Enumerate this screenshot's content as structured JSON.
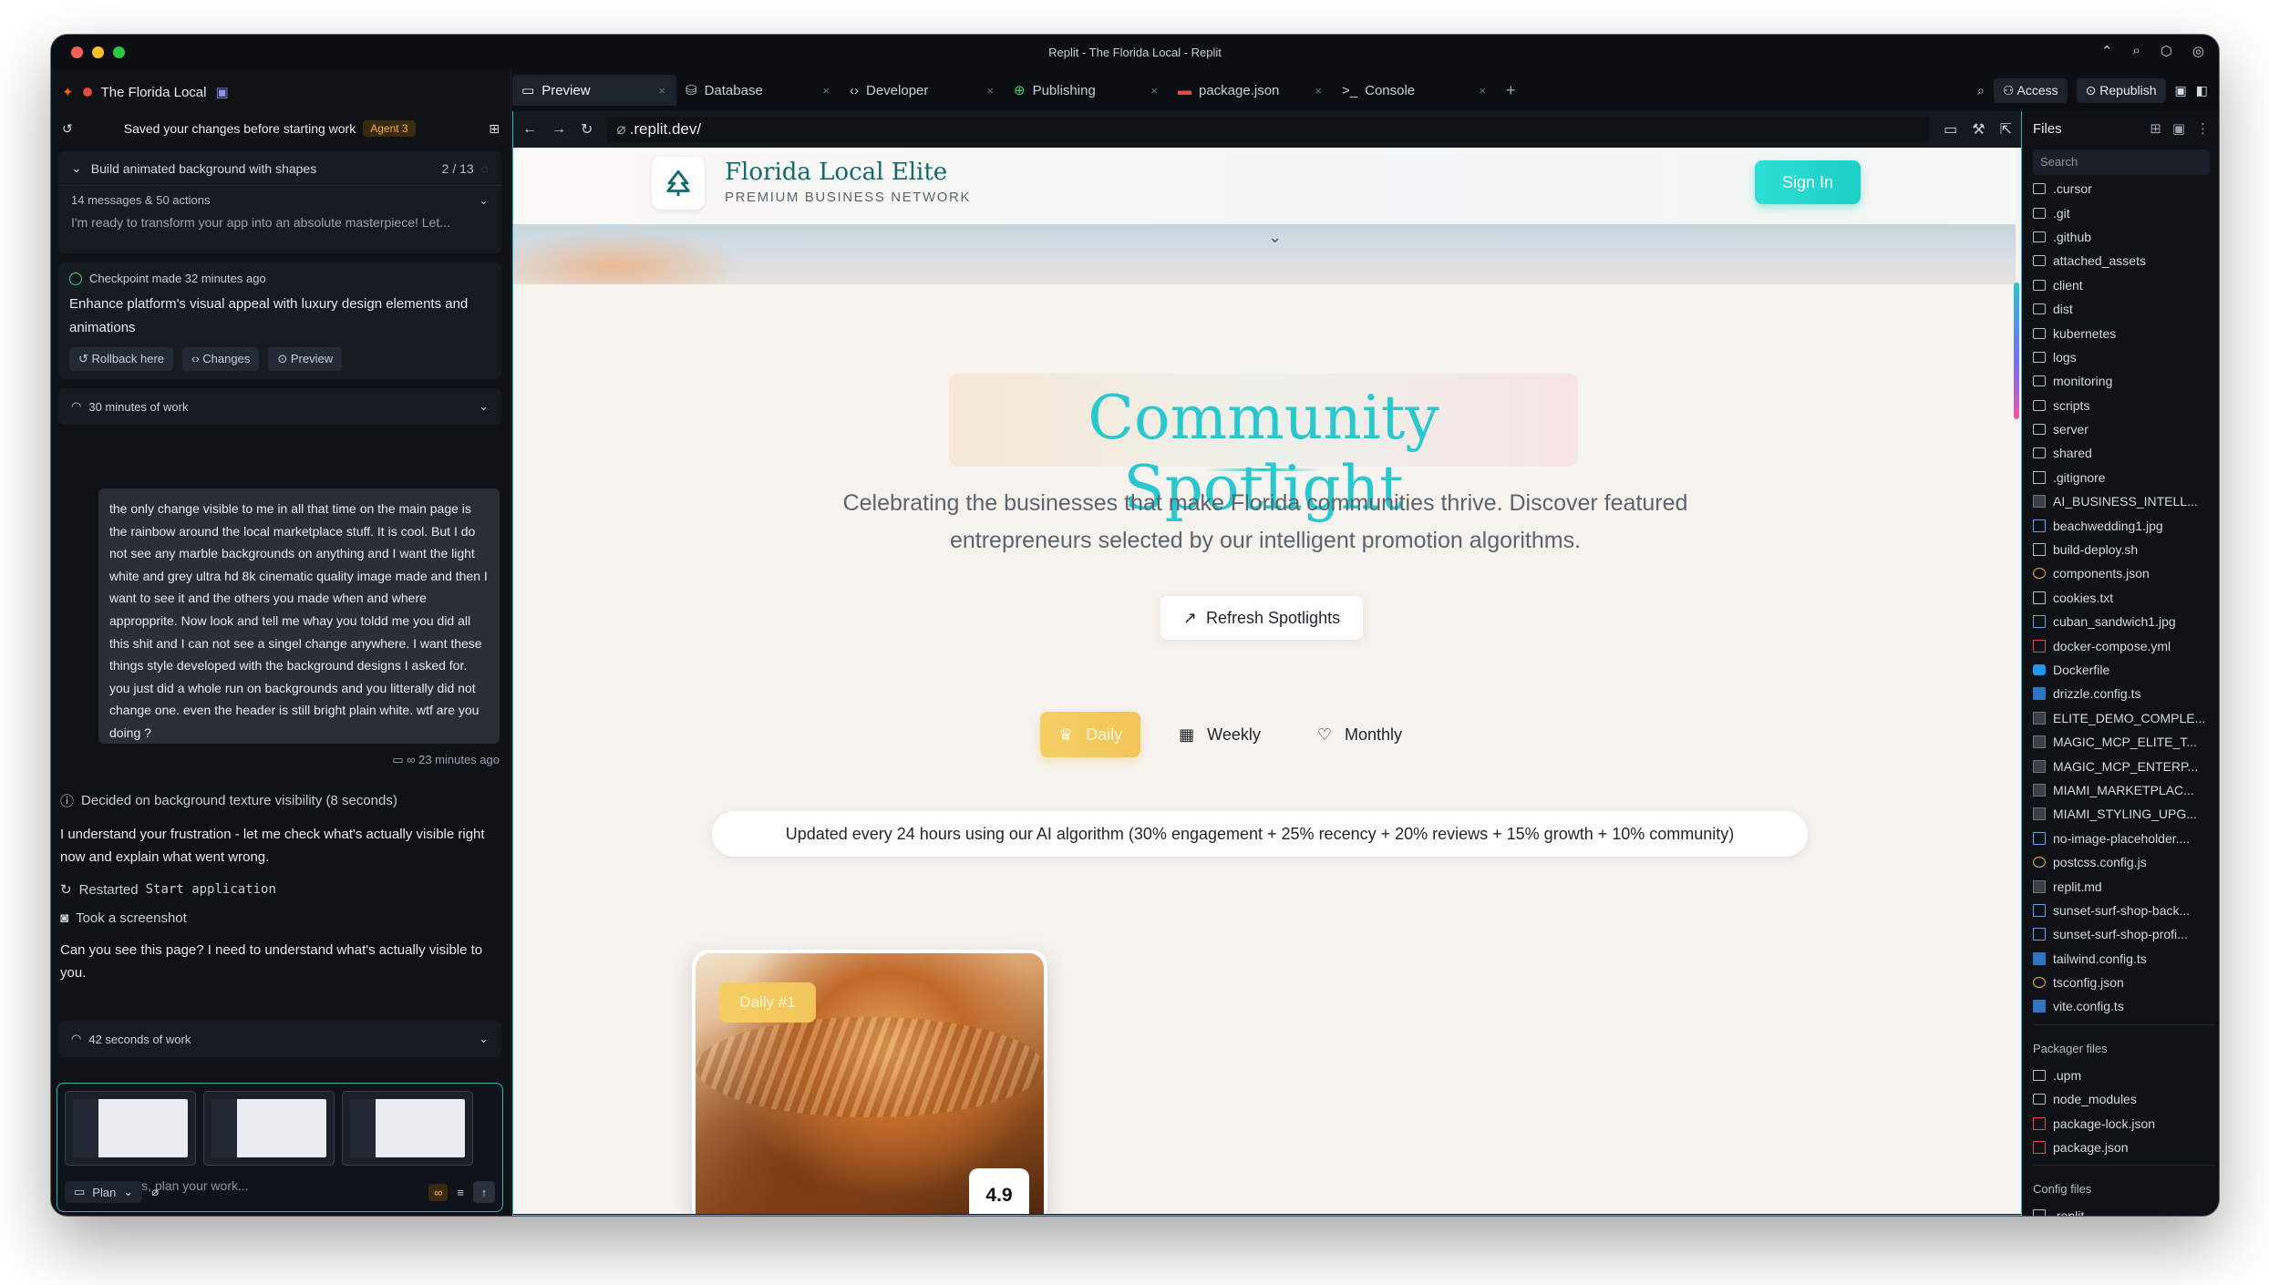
{
  "window": {
    "title": "Replit - The Florida Local - Replit"
  },
  "left_panel": {
    "project_name": "The Florida Local",
    "save_message": "Saved your changes before starting work",
    "agent_badge": "Agent 3",
    "task": {
      "title": "Build animated background with shapes",
      "progress": "2 / 13",
      "summary": "14 messages & 50 actions",
      "preview": "I'm ready to transform your app into an absolute masterpiece! Let..."
    },
    "checkpoint": {
      "title": "Checkpoint made 32 minutes ago",
      "description": "Enhance platform's visual appeal with luxury design elements and animations",
      "rollback": "Rollback here",
      "changes": "Changes",
      "preview": "Preview"
    },
    "work_30": "30 minutes of work",
    "user_message": "the only change visible to me in all that time on the main page is the rainbow around the local marketplace stuff. It is cool. But I do not see any marble backgrounds on anything and I want the light white and grey ultra hd 8k cinematic quality image made and then I want to see it and the others you made when and where appropprite. Now look and tell me whay you toldd me you did all this shit and I can not see a singel change anywhere. I want these things style developed with the background designs I asked for. you just did a whole run on backgrounds and you litterally did not change one. even the header is still bright plain white. wtf are you doing ?",
    "user_message_time": "23 minutes ago",
    "decided": "Decided on background texture visibility (8 seconds)",
    "agent_reply": "I understand your frustration - let me check what's actually visible right now and explain what went wrong.",
    "restarted_label": "Restarted",
    "restarted_cmd": "Start application",
    "screenshot": "Took a screenshot",
    "question": "Can you see this page? I need to understand what's actually visible to you.",
    "work_42": "42 seconds of work",
    "composer_placeholder": "Ask questions, plan your work...",
    "plan_label": "Plan"
  },
  "tabs": [
    {
      "label": "Preview",
      "icon": "monitor-icon"
    },
    {
      "label": "Database",
      "icon": "database-icon"
    },
    {
      "label": "Developer",
      "icon": "code-icon"
    },
    {
      "label": "Publishing",
      "icon": "globe-icon"
    },
    {
      "label": "package.json",
      "icon": "npm-icon"
    },
    {
      "label": "Console",
      "icon": "terminal-icon"
    }
  ],
  "top_right": {
    "access": "Access",
    "republish": "Republish"
  },
  "url": ".replit.dev/",
  "site": {
    "brand_name": "Florida Local Elite",
    "brand_tag": "PREMIUM BUSINESS NETWORK",
    "sign_in": "Sign In",
    "heading": "Community Spotlight",
    "subheading": "Celebrating the businesses that make Florida communities thrive. Discover featured entrepreneurs selected by our intelligent promotion algorithms.",
    "refresh": "Refresh Spotlights",
    "periods": [
      "Daily",
      "Weekly",
      "Monthly"
    ],
    "update_note": "Updated every 24 hours using our AI algorithm (30% engagement + 25% recency + 20% reviews + 15% growth + 10% community)",
    "card_badge": "Daily #1",
    "card_rating": "4.9"
  },
  "files": {
    "title": "Files",
    "search": "Search",
    "items": [
      {
        "name": ".cursor",
        "type": "folder"
      },
      {
        "name": ".git",
        "type": "folder"
      },
      {
        "name": ".github",
        "type": "folder"
      },
      {
        "name": "attached_assets",
        "type": "folder"
      },
      {
        "name": "client",
        "type": "folder"
      },
      {
        "name": "dist",
        "type": "folder"
      },
      {
        "name": "kubernetes",
        "type": "folder"
      },
      {
        "name": "logs",
        "type": "folder"
      },
      {
        "name": "monitoring",
        "type": "folder"
      },
      {
        "name": "scripts",
        "type": "folder"
      },
      {
        "name": "server",
        "type": "folder"
      },
      {
        "name": "shared",
        "type": "folder"
      },
      {
        "name": ".gitignore",
        "type": "file"
      },
      {
        "name": "AI_BUSINESS_INTELL...",
        "type": "md"
      },
      {
        "name": "beachwedding1.jpg",
        "type": "img"
      },
      {
        "name": "build-deploy.sh",
        "type": "file"
      },
      {
        "name": "components.json",
        "type": "json"
      },
      {
        "name": "cookies.txt",
        "type": "file"
      },
      {
        "name": "cuban_sandwich1.jpg",
        "type": "img"
      },
      {
        "name": "docker-compose.yml",
        "type": "red"
      },
      {
        "name": "Dockerfile",
        "type": "blue"
      },
      {
        "name": "drizzle.config.ts",
        "type": "ts"
      },
      {
        "name": "ELITE_DEMO_COMPLE...",
        "type": "md"
      },
      {
        "name": "MAGIC_MCP_ELITE_T...",
        "type": "md"
      },
      {
        "name": "MAGIC_MCP_ENTERP...",
        "type": "md"
      },
      {
        "name": "MIAMI_MARKETPLAC...",
        "type": "md"
      },
      {
        "name": "MIAMI_STYLING_UPG...",
        "type": "md"
      },
      {
        "name": "no-image-placeholder....",
        "type": "img"
      },
      {
        "name": "postcss.config.js",
        "type": "json"
      },
      {
        "name": "replit.md",
        "type": "md"
      },
      {
        "name": "sunset-surf-shop-back...",
        "type": "img"
      },
      {
        "name": "sunset-surf-shop-profi...",
        "type": "img"
      },
      {
        "name": "tailwind.config.ts",
        "type": "ts"
      },
      {
        "name": "tsconfig.json",
        "type": "json"
      },
      {
        "name": "vite.config.ts",
        "type": "ts"
      }
    ],
    "packager_label": "Packager files",
    "packager_items": [
      {
        "name": ".upm",
        "type": "folder"
      },
      {
        "name": "node_modules",
        "type": "folder"
      },
      {
        "name": "package-lock.json",
        "type": "red"
      },
      {
        "name": "package.json",
        "type": "red"
      }
    ],
    "config_label": "Config files",
    "config_items": [
      {
        "name": ".replit",
        "type": "file"
      }
    ]
  }
}
